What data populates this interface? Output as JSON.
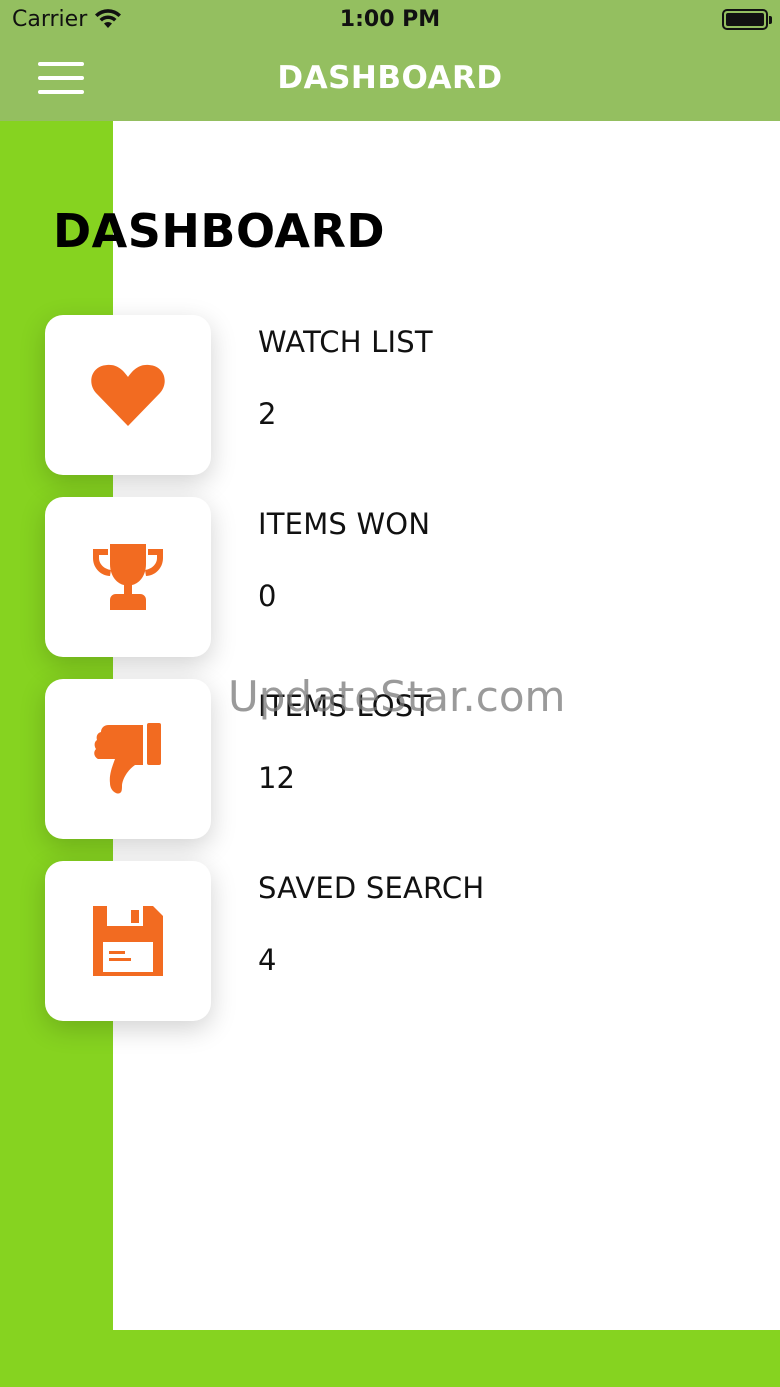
{
  "status_bar": {
    "carrier": "Carrier",
    "time": "1:00 PM"
  },
  "nav": {
    "title": "DASHBOARD",
    "menu_icon": "hamburger-menu-icon"
  },
  "page": {
    "title": "DASHBOARD"
  },
  "colors": {
    "nav_bar": "#94bf60",
    "side_green": "#86d320",
    "icon_orange": "#f26b21"
  },
  "stats": [
    {
      "label": "WATCH LIST",
      "value": "2",
      "icon": "heart-icon"
    },
    {
      "label": "ITEMS WON",
      "value": "0",
      "icon": "trophy-icon"
    },
    {
      "label": "ITEMS LOST",
      "value": "12",
      "icon": "thumbs-down-icon"
    },
    {
      "label": "SAVED SEARCH",
      "value": "4",
      "icon": "floppy-disk-icon"
    }
  ],
  "watermark": "UpdateStar.com"
}
